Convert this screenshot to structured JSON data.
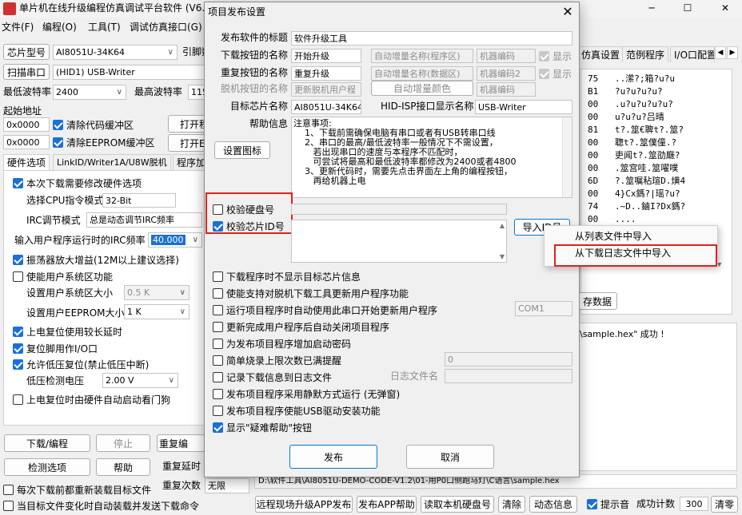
{
  "main": {
    "title": "单片机在线升级编程仿真调试平台软件 (V6.9",
    "menu": [
      "文件(F)",
      "编程(O)",
      "工具(T)",
      "调试仿真接口(G)"
    ],
    "chip_type_label": "芯片型号",
    "chip_type_value": "AI8051U-34K64",
    "lead_label": "引脚数",
    "scan_port_button": "扫描串口",
    "port_value": "(HID1) USB-Writer",
    "min_baud_label": "最低波特率",
    "min_baud_value": "2400",
    "max_baud_label": "最高波特率",
    "max_baud_value": "115",
    "start_addr_label": "起始地址",
    "addr1": "0x0000",
    "clear_code_label": "清除代码缓冲区",
    "open1": "打开程",
    "addr2": "0x0000",
    "clear_eeprom_label": "清除EEPROM缓冲区",
    "open2": "打开EE",
    "left_tabs": [
      "硬件选项",
      "LinkID/Writer1A/U8W脱机",
      "程序加"
    ],
    "hw_options": {
      "modify_label": "本次下载需要修改硬件选项",
      "cpu_mode_label": "选择CPU指令模式",
      "cpu_mode_value": "32-Bit",
      "irc_mode_label": "IRC调节模式",
      "irc_mode_value": "总是动态调节IRC频率",
      "irc_freq_label": "输入用户程序运行时的IRC频率",
      "irc_freq_value": "40.000",
      "amp_label": "振荡器放大增益(12M以上建议选择)",
      "sys_area_label": "使能用户系统区功能",
      "sys_size_label": "设置用户系统区大小",
      "sys_size_value": "0.5 K",
      "eeprom_size_label": "设置用户EEPROM大小",
      "eeprom_size_value": "1 K",
      "power_delay_label": "上电复位使用较长延时",
      "reset_io_label": "复位脚用作I/O口",
      "lvd_label": "允许低压复位(禁止低压中断)",
      "lvd_voltage_label": "低压检测电压",
      "lvd_voltage_value": "2.00 V",
      "watchdog_label": "上电复位时由硬件自动启动看门狗"
    },
    "download_button": "下载/编程",
    "stop_button": "停止",
    "redownload_button": "重复编",
    "check_button": "检测选项",
    "help_button": "帮助",
    "repeat_delay_label": "重复延时",
    "reload_label": "每次下载前都重新装载目标文件",
    "repeat_count_label": "重复次数",
    "repeat_count_value": "无限",
    "auto_load_label": "当目标文件变化时自动装载并发送下载命令",
    "right_tabs": [
      "仿真设置",
      "范例程序",
      "I/O口配置"
    ],
    "hex_addr": [
      "75",
      "B1",
      "00",
      "00",
      "81",
      "00",
      "00",
      "00",
      "6D",
      "00",
      "74",
      "00",
      "04",
      "00",
      "00"
    ],
    "hex_ascii": [
      "..潆?;箱?u?u",
      "?u?u?u?u?",
      ".u?u?u?u?u?",
      "u?u?u?吕晴",
      "t?.筮€聛t?.筮?",
      "聦t?.筮僕僮.?",
      "吏闻t?.筮劭廰?",
      ".筮宫哇.筮嚁噗",
      "?.筮嘱秥瑄D.熿4",
      "4}Cx鎷?|瑶?u?",
      ".~D..鏀I?Dx鎷?",
      "...."
    ],
    "save_data_button": "存数据",
    "log_text": "\\sample.hex\" 成功 !",
    "path_text": "D:\\软件工具\\AI8051U-DEMO-CODE-V1.2\\01-用P0口侧跑马灯\\C语言\\sample.hex",
    "bottom_buttons": [
      "远程现场升级APP发布",
      "发布APP帮助",
      "读取本机硬盘号",
      "清除",
      "动态信息"
    ],
    "beep_label": "提示音",
    "success_label": "成功计数",
    "success_value": "300",
    "clear_zero_button": "清零"
  },
  "dialog": {
    "title": "项目发布设置",
    "close_icon": "close-icon",
    "fields": {
      "release_title_label": "发布软件的标题",
      "release_title_value": "软件升级工具",
      "download_btn_label": "下载按钮的名称",
      "download_btn_value": "开始升级",
      "auto_inc_program_label": "自动增量名称(程序区)",
      "machine_code_label": "机器编码",
      "show1_label": "显示",
      "repeat_btn_label": "重复按钮的名称",
      "repeat_btn_value": "重复升级",
      "auto_inc_data_label": "自动增量名称(数据区)",
      "machine_code2_label": "机器编码2",
      "show2_label": "显示",
      "offline_btn_label": "脱机按钮的名称",
      "offline_btn_value": "更新脱机用户程",
      "auto_inc_color_button": "自动增量颜色",
      "machine_code_placeholder": "机器编码",
      "target_chip_label": "目标芯片名称",
      "target_chip_value": "AI8051U-34K64",
      "hid_label": "HID-ISP接口显示名称",
      "hid_value": "USB-Writer",
      "help_info_label": "帮助信息",
      "set_icon_button": "设置图标",
      "help_text": "注意事项:\n    1、下载前需确保电脑有串口或者有USB转串口线\n    2、串口的最高/最低波特率一般情况下不需设置，\n       若出现串口的速度与本程序不匹配时，\n       可尝试将最高和最低波特率都修改为2400或者4800\n    3、更新代码时，需要先点击界面左上角的编程按钮，\n       再给机器上电"
    },
    "verify_disk_label": "校验硬盘号",
    "verify_chip_label": "校验芯片ID号",
    "import_id_button": "导入ID号",
    "options": [
      {
        "label": "下载程序时不显示目标芯片信息",
        "checked": false
      },
      {
        "label": "使能支持对脱机下载工具更新用户程序功能",
        "checked": false
      },
      {
        "label": "运行项目程序时自动使用此串口开始更新用户程序",
        "checked": false
      },
      {
        "label": "更新完成用户程序后自动关闭项目程序",
        "checked": false
      },
      {
        "label": "为发布项目程序增加启动密码",
        "checked": false
      },
      {
        "label": "简单烧录上限次数已满提醒",
        "checked": false
      },
      {
        "label": "记录下载信息到日志文件",
        "checked": false
      },
      {
        "label": "发布项目程序采用静默方式运行 (无弹窗)",
        "checked": false
      },
      {
        "label": "发布项目程序使能USB驱动安装功能",
        "checked": false
      },
      {
        "label": "显示\"疑难帮助\"按钮",
        "checked": true
      }
    ],
    "com_value": "COM1",
    "count_value": "0",
    "log_file_label": "日志文件名",
    "publish_button": "发布",
    "cancel_button": "取消"
  },
  "context_menu": {
    "items": [
      "从列表文件中导入",
      "从下载日志文件中导入"
    ]
  },
  "highlight_color": "#e02020",
  "accent_color": "#1a6fd8"
}
